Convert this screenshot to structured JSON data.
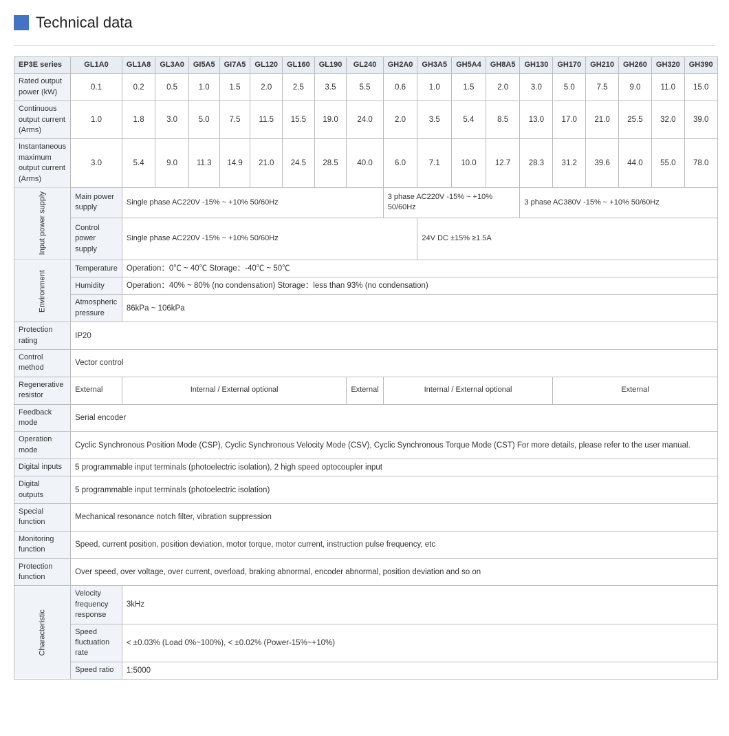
{
  "page": {
    "title": "Technical data",
    "title_icon_color": "#4472C4"
  },
  "table": {
    "series_label": "EP3E series",
    "columns": [
      "GL1A0",
      "GL1A8",
      "GL3A0",
      "GI5A5",
      "GI7A5",
      "GL120",
      "GL160",
      "GL190",
      "GL240",
      "GH2A0",
      "GH3A5",
      "GH5A4",
      "GH8A5",
      "GH130",
      "GH170",
      "GH210",
      "GH260",
      "GH320",
      "GH390"
    ],
    "rows": {
      "rated_output_power": {
        "label": "Rated output power (kW)",
        "values": [
          "0.1",
          "0.2",
          "0.5",
          "1.0",
          "1.5",
          "2.0",
          "2.5",
          "3.5",
          "5.5",
          "0.6",
          "1.0",
          "1.5",
          "2.0",
          "3.0",
          "5.0",
          "7.5",
          "9.0",
          "11.0",
          "15.0"
        ]
      },
      "continuous_output_current": {
        "label": "Continuous output current (Arms)",
        "values": [
          "1.0",
          "1.8",
          "3.0",
          "5.0",
          "7.5",
          "11.5",
          "15.5",
          "19.0",
          "24.0",
          "2.0",
          "3.5",
          "5.4",
          "8.5",
          "13.0",
          "17.0",
          "21.0",
          "25.5",
          "32.0",
          "39.0"
        ]
      },
      "instantaneous_maximum_current": {
        "label": "Instantaneous maximum output current (Arms)",
        "values": [
          "3.0",
          "5.4",
          "9.0",
          "11.3",
          "14.9",
          "21.0",
          "24.5",
          "28.5",
          "40.0",
          "6.0",
          "7.1",
          "10.0",
          "12.7",
          "28.3",
          "31.2",
          "39.6",
          "44.0",
          "55.0",
          "78.0"
        ]
      }
    },
    "input_power_supply": {
      "group_label": "Input power supply",
      "main_power_supply": {
        "label": "Main power supply",
        "cell1": "Single phase AC220V -15% ~ +10% 50/60Hz",
        "cell2": "3 phase AC220V -15% ~ +10%  50/60Hz",
        "cell3": "3 phase AC380V -15% ~ +10%  50/60Hz"
      },
      "control_power_supply": {
        "label": "Control power supply",
        "cell1": "Single phase    AC220V   -15%  ~  +10%   50/60Hz",
        "cell2": "24V DC    ±15%   ≥1.5A"
      }
    },
    "environment": {
      "group_label": "Environment",
      "temperature": {
        "label": "Temperature",
        "value": "Operation：0℃ ~ 40℃             Storage：-40℃ ~ 50℃"
      },
      "humidity": {
        "label": "Humidity",
        "value": "Operation：40%  ~ 80%  (no condensation)           Storage：less than 93% (no condensation)"
      },
      "atmospheric_pressure": {
        "label": "Atmospheric pressure",
        "value": "86kPa  ~ 106kPa"
      }
    },
    "protection_rating": {
      "label": "Protection rating",
      "value": "IP20"
    },
    "control_method": {
      "label": "Control method",
      "value": "Vector control"
    },
    "regenerative_resistor": {
      "label": "Regenerative resistor",
      "cell1": "External",
      "cell2": "Internal / External optional",
      "cell3": "External",
      "cell4": "Internal / External optional",
      "cell5": "External"
    },
    "feedback_mode": {
      "label": "Feedback mode",
      "value": "Serial encoder"
    },
    "operation_mode": {
      "label": "Operation mode",
      "value": "Cyclic Synchronous Position Mode (CSP), Cyclic Synchronous Velocity Mode (CSV), Cyclic Synchronous Torque Mode (CST) For more details, please refer to  the user manual."
    },
    "digital_inputs": {
      "label": "Digital inputs",
      "value": "5 programmable input terminals (photoelectric isolation), 2 high speed optocoupler input"
    },
    "digital_outputs": {
      "label": "Digital outputs",
      "value": "5 programmable input terminals (photoelectric isolation)"
    },
    "special_function": {
      "label": "Special function",
      "value": "Mechanical resonance notch filter, vibration suppression"
    },
    "monitoring_function": {
      "label": "Monitoring function",
      "value": "Speed, current position, position deviation, motor torque, motor current, instruction pulse frequency, etc"
    },
    "protection_function": {
      "label": "Protection function",
      "value": "Over speed, over voltage, over current, overload, braking abnormal, encoder abnormal, position deviation and so on"
    },
    "characteristic": {
      "group_label": "Characteristic",
      "velocity_frequency_response": {
        "label": "Velocity frequency response",
        "value": "3kHz"
      },
      "speed_fluctuation_rate": {
        "label": "Speed fluctuation rate",
        "value": "< ±0.03% (Load 0%~100%),   < ±0.02% (Power-15%~+10%)"
      },
      "speed_ratio": {
        "label": "Speed ratio",
        "value": "1:5000"
      }
    }
  }
}
